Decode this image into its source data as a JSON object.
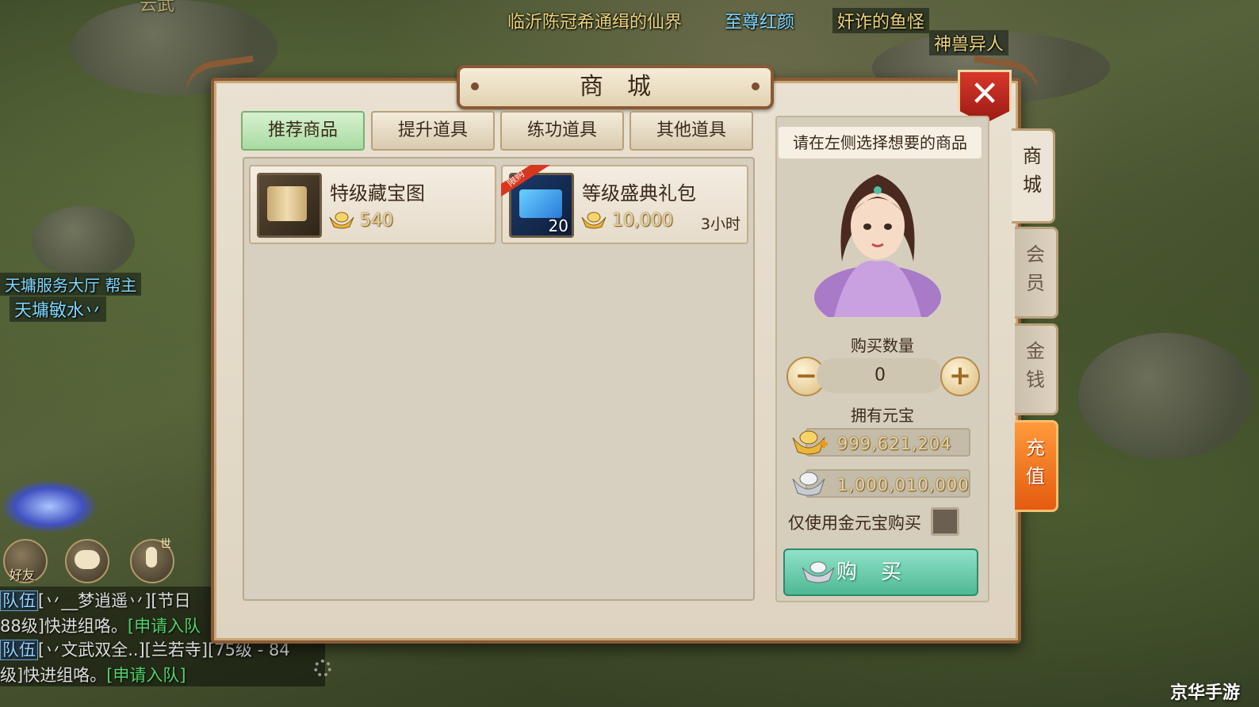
{
  "scene": {
    "top_banner": "临沂陈冠希通缉的仙界",
    "top_title_right": "至尊红颜",
    "monster_name": "奸诈的鱼怪",
    "monster_title": "神兽异人",
    "npc_guild": "天墉服务大厅 帮主",
    "npc_name": "天墉敏水丷",
    "corner_fragment": "云武"
  },
  "hud": {
    "friend_label": "好友",
    "mic_badge": "世"
  },
  "chat": {
    "lines": [
      {
        "tag": "队伍",
        "text": "[丷__梦逍遥丷][节日"
      },
      {
        "tag": "",
        "text": "88级]快进组咯。",
        "link": "[申请入队"
      },
      {
        "tag": "队伍",
        "text": "[丷文武双全..][兰若寺][75级 - 84"
      },
      {
        "tag": "",
        "text": "级]快进组咯。",
        "link": "[申请入队]"
      }
    ]
  },
  "shop": {
    "title": "商城",
    "close_icon": "close-icon",
    "tabs": [
      {
        "label": "推荐商品",
        "active": true
      },
      {
        "label": "提升道具",
        "active": false
      },
      {
        "label": "练功道具",
        "active": false
      },
      {
        "label": "其他道具",
        "active": false
      }
    ],
    "items": [
      {
        "name": "特级藏宝图",
        "price": "540",
        "icon": "treasure-map-icon"
      },
      {
        "name": "等级盛典礼包",
        "price": "10,000",
        "time": "3小时",
        "count": "20",
        "ribbon": "限购",
        "icon": "gift-pack-icon"
      }
    ],
    "hint": "请在左侧选择想要的商品",
    "quantity_label": "购买数量",
    "quantity": "0",
    "owned_label": "拥有元宝",
    "gold_ingot": "999,621,204",
    "silver_ingot": "1,000,010,000",
    "gold_only_label": "仅使用金元宝购买",
    "buy_label": "购买",
    "side_tabs": [
      {
        "label": "商城",
        "state": "active"
      },
      {
        "label": "会员",
        "state": "idle"
      },
      {
        "label": "金钱",
        "state": "idle"
      },
      {
        "label": "充值",
        "state": "charge"
      }
    ]
  },
  "watermark": "京华手游"
}
